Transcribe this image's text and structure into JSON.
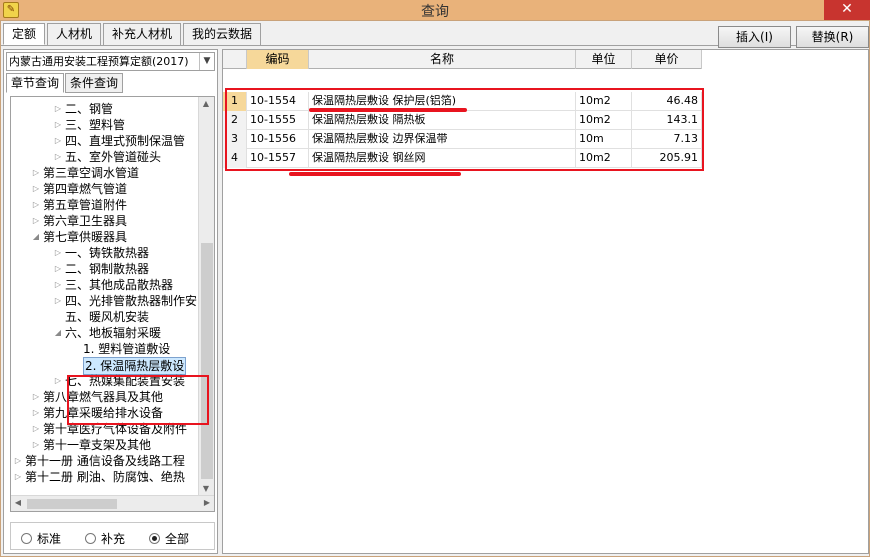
{
  "window": {
    "title": "查询",
    "close_glyph": "✕"
  },
  "tabs": [
    "定额",
    "人材机",
    "补充人材机",
    "我的云数据"
  ],
  "toolbar": {
    "insert_label": "插入(I)",
    "replace_label": "替换(R)"
  },
  "quota_library": "内蒙古通用安装工程预算定额(2017)",
  "subtabs": [
    "章节查询",
    "条件查询"
  ],
  "tree": [
    {
      "label": "二、钢管"
    },
    {
      "label": "三、塑料管"
    },
    {
      "label": "四、直埋式预制保温管"
    },
    {
      "label": "五、室外管道碰头"
    },
    {
      "label": "第三章空调水管道"
    },
    {
      "label": "第四章燃气管道"
    },
    {
      "label": "第五章管道附件"
    },
    {
      "label": "第六章卫生器具"
    },
    {
      "label": "第七章供暖器具"
    },
    {
      "label": "一、铸铁散热器"
    },
    {
      "label": "二、钢制散热器"
    },
    {
      "label": "三、其他成品散热器"
    },
    {
      "label": "四、光排管散热器制作安"
    },
    {
      "label": "五、暖风机安装"
    },
    {
      "label": "六、地板辐射采暖"
    },
    {
      "label": "1. 塑料管道敷设"
    },
    {
      "label": "2. 保温隔热层敷设"
    },
    {
      "label": "七、热媒集配装置安装"
    },
    {
      "label": "第八章燃气器具及其他"
    },
    {
      "label": "第九章采暖给排水设备"
    },
    {
      "label": "第十章医疗气体设备及附件"
    },
    {
      "label": "第十一章支架及其他"
    },
    {
      "label": "第十一册 通信设备及线路工程"
    },
    {
      "label": "第十二册 刷油、防腐蚀、绝热"
    }
  ],
  "filter": {
    "options": [
      "标准",
      "补充",
      "全部"
    ],
    "selected": "全部"
  },
  "table": {
    "headers": [
      "编码",
      "名称",
      "单位",
      "单价"
    ],
    "rows": [
      {
        "num": "1",
        "code": "10-1554",
        "name": "保温隔热层敷设 保护层(铝箔)",
        "unit": "10m2",
        "price": "46.48"
      },
      {
        "num": "2",
        "code": "10-1555",
        "name": "保温隔热层敷设 隔热板",
        "unit": "10m2",
        "price": "143.1"
      },
      {
        "num": "3",
        "code": "10-1556",
        "name": "保温隔热层敷设 边界保温带",
        "unit": "10m",
        "price": "7.13"
      },
      {
        "num": "4",
        "code": "10-1557",
        "name": "保温隔热层敷设 钢丝网",
        "unit": "10m2",
        "price": "205.91"
      }
    ]
  },
  "icons": {
    "tree_collapsed": "▷",
    "tree_expanded": "◢",
    "scroll_up": "▲",
    "scroll_down": "▼",
    "scroll_left": "◀",
    "scroll_right": "▶",
    "dropdown": "▼",
    "app": "✎"
  },
  "colors": {
    "title_bar": "#e9b27a",
    "annotation_red": "#e8141f",
    "selected_header": "#f6d89a",
    "close_button": "#c8342f"
  }
}
